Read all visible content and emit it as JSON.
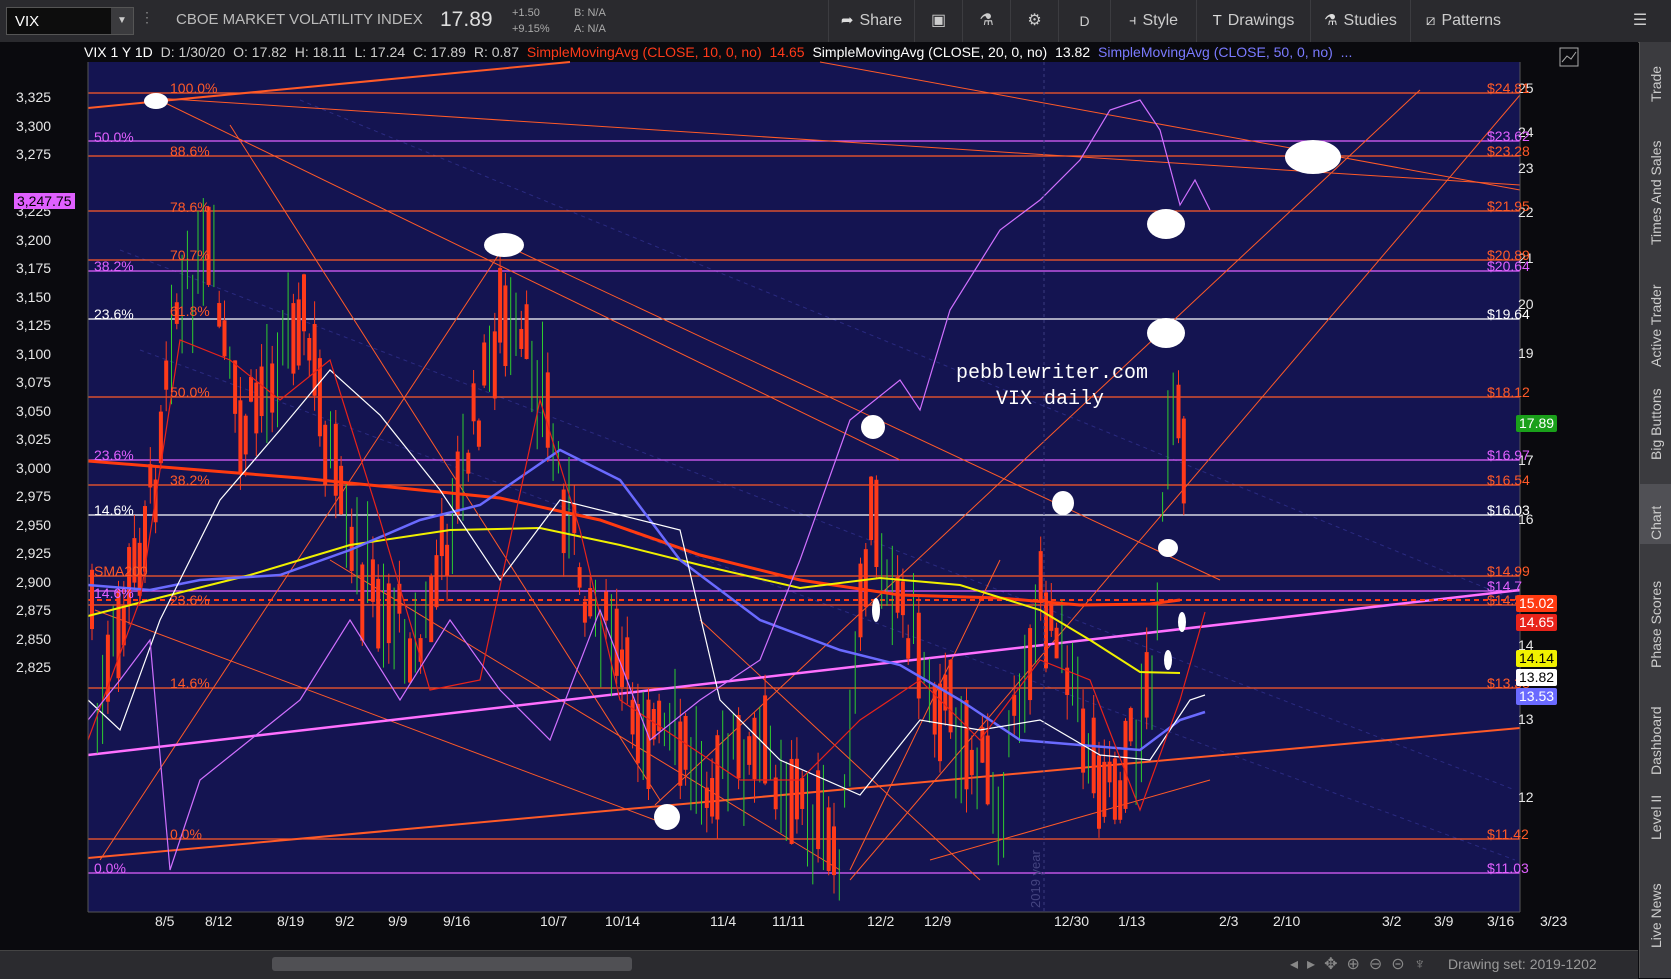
{
  "toolbar": {
    "symbol": "VIX",
    "title": "CBOE MARKET VOLATILITY INDEX",
    "last": "17.89",
    "change": "+1.50",
    "change_pct": "+9.15%",
    "bid": "B: N/A",
    "ask": "A: N/A",
    "share": "Share",
    "period": "D",
    "style": "Style",
    "drawings": "Drawings",
    "studies": "Studies",
    "patterns": "Patterns"
  },
  "legend": {
    "symbol": "VIX 1 Y 1D",
    "date": "D: 1/30/20",
    "open": "O: 17.82",
    "high": "H: 18.11",
    "low": "L: 17.24",
    "close": "C: 17.89",
    "range": "R: 0.87",
    "sma10": "SimpleMovingAvg (CLOSE, 10, 0, no)",
    "sma10_val": "14.65",
    "sma20": "SimpleMovingAvg (CLOSE, 20, 0, no)",
    "sma20_val": "13.82",
    "sma50": "SimpleMovingAvg (CLOSE, 50, 0, no)",
    "more": "..."
  },
  "left_axis": [
    "3,325",
    "3,300",
    "3,275",
    "3,250",
    "3,225",
    "3,200",
    "3,175",
    "3,150",
    "3,125",
    "3,100",
    "3,075",
    "3,050",
    "3,025",
    "3,000",
    "2,975",
    "2,950",
    "2,925",
    "2,900",
    "2,875",
    "2,850",
    "2,825"
  ],
  "left_axis_hidden_index": 3,
  "left_badge": "3,247.75",
  "right_axis": [
    "25",
    "24",
    "23",
    "22",
    "21",
    "20",
    "19",
    "17",
    "16",
    "14",
    "13",
    "12"
  ],
  "x_axis": [
    "8/5",
    "8/12",
    "8/19",
    "9/2",
    "9/9",
    "9/16",
    "10/7",
    "10/14",
    "11/4",
    "11/11",
    "12/2",
    "12/9",
    "12/30",
    "1/13",
    "2/3",
    "2/10",
    "3/2",
    "3/9",
    "3/16",
    "3/23"
  ],
  "fib_left": [
    {
      "t": "100.0%",
      "c": "#ff5a28"
    },
    {
      "t": "50.0%",
      "c": "#e060ff"
    },
    {
      "t": "88.6%",
      "c": "#ff5a28"
    },
    {
      "t": "78.6%",
      "c": "#ff5a28"
    },
    {
      "t": "70.7%",
      "c": "#ff5a28"
    },
    {
      "t": "38.2%",
      "c": "#e060ff"
    },
    {
      "t": "61.8%",
      "c": "#ff5a28"
    },
    {
      "t": "23.6%",
      "c": "#ffffff"
    },
    {
      "t": "50.0%",
      "c": "#ff5a28"
    },
    {
      "t": "23.6%",
      "c": "#e060ff"
    },
    {
      "t": "38.2%",
      "c": "#ff5a28"
    },
    {
      "t": "14.6%",
      "c": "#ffffff"
    },
    {
      "t": "SMA200",
      "c": "#ff5a28"
    },
    {
      "t": "14.6%",
      "c": "#e060ff"
    },
    {
      "t": "23.6%",
      "c": "#ff5a28"
    },
    {
      "t": "14.6%",
      "c": "#ff5a28"
    },
    {
      "t": "0.0%",
      "c": "#ff5a28"
    },
    {
      "t": "0.0%",
      "c": "#e060ff"
    }
  ],
  "fib_right": [
    {
      "t": "$24.81",
      "c": "#ff5a28"
    },
    {
      "t": "$23.62",
      "c": "#e060ff"
    },
    {
      "t": "$23.28",
      "c": "#ff5a28"
    },
    {
      "t": "$21.95",
      "c": "#ff5a28"
    },
    {
      "t": "$20.89",
      "c": "#ff5a28"
    },
    {
      "t": "$20.64",
      "c": "#e060ff"
    },
    {
      "t": "$19.64",
      "c": "#ffffff"
    },
    {
      "t": "$18.12",
      "c": "#ff5a28"
    },
    {
      "t": "$16.97",
      "c": "#e060ff"
    },
    {
      "t": "$16.54",
      "c": "#ff5a28"
    },
    {
      "t": "$16.03",
      "c": "#ffffff"
    },
    {
      "t": "$14.99",
      "c": "#ff5a28"
    },
    {
      "t": "$14.7",
      "c": "#e060ff"
    },
    {
      "t": "$14.58",
      "c": "#ff5a28"
    },
    {
      "t": "$13.38",
      "c": "#ff5a28"
    },
    {
      "t": "$11.42",
      "c": "#ff5a28"
    },
    {
      "t": "$11.03",
      "c": "#e060ff"
    }
  ],
  "price_badges": [
    {
      "t": "17.89",
      "bg": "#1aa01a",
      "fg": "#ffffff"
    },
    {
      "t": "15.02",
      "bg": "#ff3a10",
      "fg": "#ffffff"
    },
    {
      "t": "14.65",
      "bg": "#e8231a",
      "fg": "#ffffff"
    },
    {
      "t": "14.14",
      "bg": "#f0f000",
      "fg": "#000000"
    },
    {
      "t": "13.82",
      "bg": "#ffffff",
      "fg": "#000000"
    },
    {
      "t": "13.53",
      "bg": "#6a6aff",
      "fg": "#ffffff"
    }
  ],
  "annotation": {
    "line1": "pebblewriter.com",
    "line2": "VIX daily"
  },
  "year_marker": "2019 year",
  "sidebar_tabs": [
    "Trade",
    "Times And Sales",
    "Active Trader",
    "Big Buttons",
    "Chart",
    "Phase Scores",
    "Dashboard",
    "Level II",
    "Live News"
  ],
  "drawing_set": "Drawing set: 2019-1202",
  "colors": {
    "chart_bg": "#141451",
    "fib_orange": "#ff5a28",
    "fib_magenta": "#e060ff",
    "sma10": "#e8231a",
    "sma20": "#ffffff",
    "sma50": "#6a6aff",
    "sma_yellow": "#f0f000"
  }
}
